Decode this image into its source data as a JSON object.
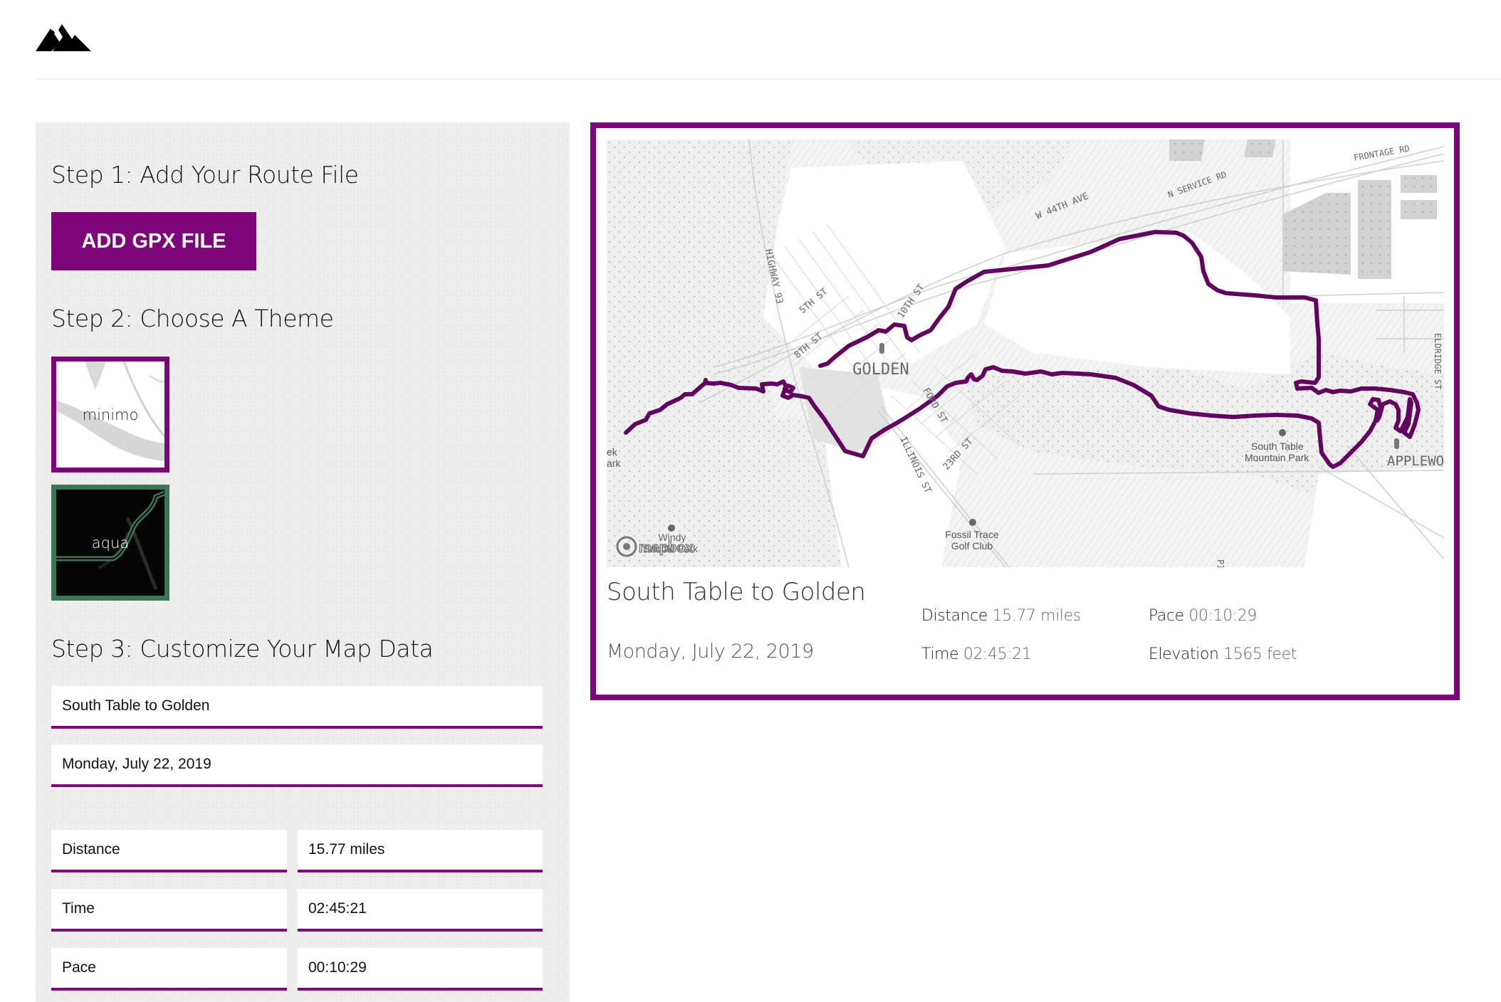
{
  "brand": {
    "logo_icon": "mountains-logo-icon"
  },
  "steps": {
    "step1": {
      "title": "Step 1: Add Your Route File",
      "button_label": "ADD GPX FILE"
    },
    "step2": {
      "title": "Step 2: Choose A Theme",
      "themes": [
        {
          "label": "minimo",
          "selected": true
        },
        {
          "label": "aqua",
          "selected": false
        }
      ]
    },
    "step3": {
      "title": "Step 3: Customize Your Map Data",
      "fields": {
        "title_value": "South Table to Golden",
        "date_value": "Monday, July 22, 2019",
        "rows": [
          {
            "label": "Distance",
            "value": "15.77 miles"
          },
          {
            "label": "Time",
            "value": "02:45:21"
          },
          {
            "label": "Pace",
            "value": "00:10:29"
          }
        ]
      }
    }
  },
  "poster": {
    "title": "South Table to Golden",
    "date": "Monday, July 22, 2019",
    "stats": [
      {
        "label": "Distance",
        "value": "15.77 miles"
      },
      {
        "label": "Pace",
        "value": "00:10:29"
      },
      {
        "label": "Time",
        "value": "02:45:21"
      },
      {
        "label": "Elevation",
        "value": "1565 feet"
      }
    ],
    "map": {
      "attribution": "mapbox",
      "labels": {
        "golden": "GOLDEN",
        "applewood": "APPLEWOOD",
        "highway93": "HIGHWAY 93",
        "st5": "5TH ST",
        "st8": "8TH ST",
        "st10": "10TH ST",
        "w44": "W 44TH AVE",
        "nservice": "N SERVICE RD",
        "frontage": "FRONTAGE RD",
        "ford": "FORD ST",
        "illinois": "ILLINOIS ST",
        "st23": "23RD ST",
        "eldridge": "ELDRIDGE ST",
        "pik": "PIK",
        "south_table_1": "South Table",
        "south_table_2": "Mountain Park",
        "fossil_1": "Fossil Trace",
        "fossil_2": "Golf Club",
        "windy_1": "Windy",
        "windy_2": "Saddle Park",
        "creek_1": "ek",
        "creek_2": "ark"
      }
    }
  },
  "colors": {
    "accent": "#7d0479",
    "aqua_border": "#3b765a",
    "panel_bg": "#eeeeed"
  }
}
